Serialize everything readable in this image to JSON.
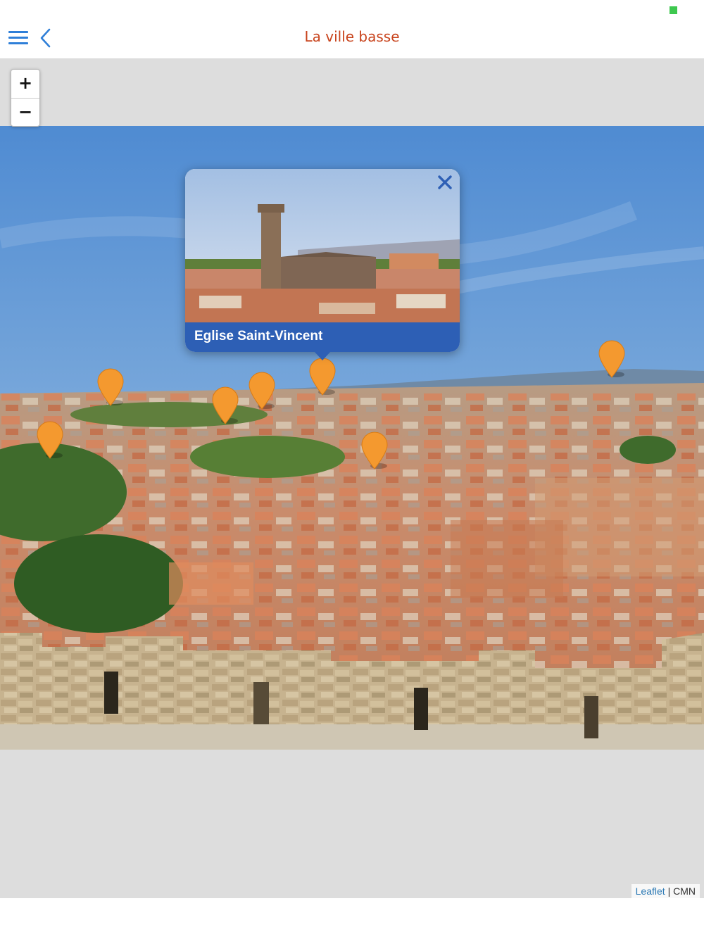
{
  "header": {
    "title": "La ville basse"
  },
  "map": {
    "zoom_in_label": "+",
    "zoom_out_label": "−",
    "popup": {
      "title": "Eglise Saint-Vincent"
    },
    "marker_count": 8,
    "attribution": {
      "link": "Leaflet",
      "separator": " | ",
      "source": "CMN"
    }
  },
  "colors": {
    "accent": "#2f7fd8",
    "title": "#c8431c",
    "marker": "#f4992f",
    "popup_bar": "#2d5fb5",
    "status": "#3ec84f"
  },
  "icons": [
    "menu-icon",
    "back-chevron-icon",
    "close-icon",
    "map-marker-icon"
  ]
}
